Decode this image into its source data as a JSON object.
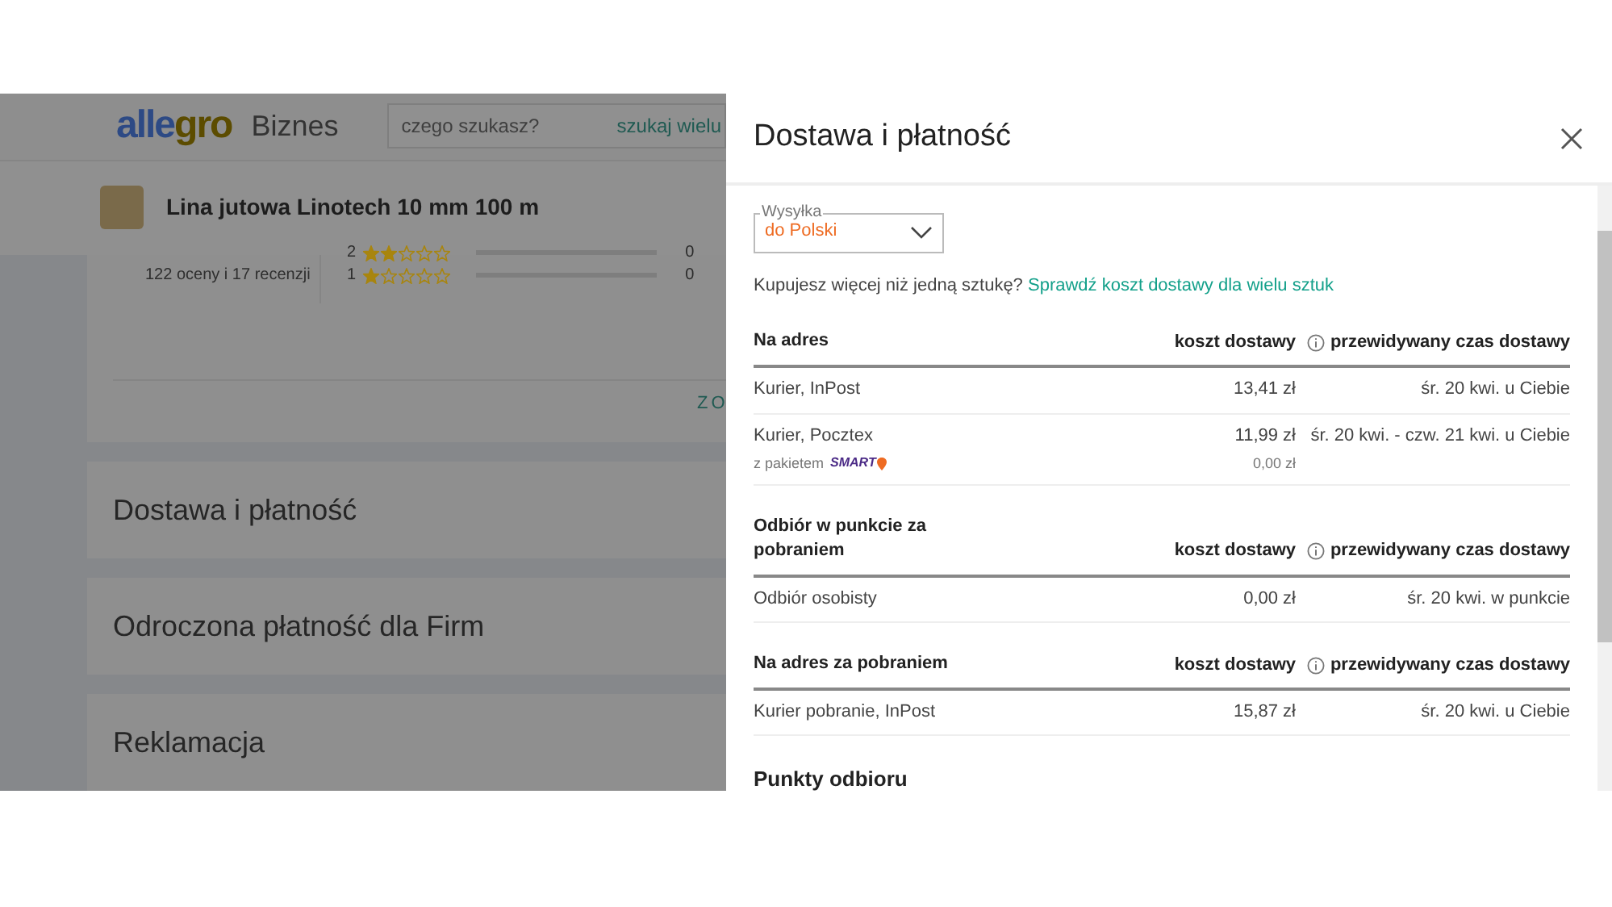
{
  "background": {
    "logo": {
      "brand": "allegro",
      "suffix": "Biznes"
    },
    "search": {
      "placeholder": "czego szukasz?",
      "link": "szukaj wielu"
    },
    "product": {
      "title": "Lina jutowa Linotech 10 mm 100 m"
    },
    "ratings": {
      "summary": "122 oceny i 17 recenzji",
      "rows": [
        {
          "label": "2",
          "stars": 2,
          "count": "0"
        },
        {
          "label": "1",
          "stars": 1,
          "count": "0"
        }
      ],
      "more_link": "ZO"
    },
    "sections": [
      "Dostawa i płatność",
      "Odroczona płatność dla Firm",
      "Reklamacja"
    ]
  },
  "panel": {
    "title": "Dostawa i płatność",
    "shipping_select": {
      "label": "Wysyłka",
      "value": "do Polski"
    },
    "multi_note": {
      "text": "Kupujesz więcej niż jedną sztukę?",
      "link": "Sprawdź koszt dostawy dla wielu sztuk"
    },
    "groups": [
      {
        "heading": "Na adres",
        "cost_heading": "koszt dostawy",
        "time_heading": "przewidywany czas dostawy",
        "rows": [
          {
            "method": "Kurier, InPost",
            "cost": "13,41 zł",
            "time": "śr. 20 kwi. u Ciebie"
          },
          {
            "method": "Kurier, Pocztex",
            "cost": "11,99 zł",
            "time": "śr. 20 kwi. - czw. 21 kwi. u Ciebie",
            "smart": {
              "label": "z pakietem",
              "badge": "SMART",
              "cost": "0,00 zł"
            }
          }
        ]
      },
      {
        "heading": "Odbiór w punkcie za pobraniem",
        "cost_heading": "koszt dostawy",
        "time_heading": "przewidywany czas dostawy",
        "rows": [
          {
            "method": "Odbiór osobisty",
            "cost": "0,00 zł",
            "time": "śr. 20 kwi. w punkcie"
          }
        ]
      },
      {
        "heading": "Na adres za pobraniem",
        "cost_heading": "koszt dostawy",
        "time_heading": "przewidywany czas dostawy",
        "rows": [
          {
            "method": "Kurier pobranie, InPost",
            "cost": "15,87 zł",
            "time": "śr. 20 kwi. u Ciebie"
          }
        ]
      }
    ],
    "pickup_heading": "Punkty odbioru"
  }
}
